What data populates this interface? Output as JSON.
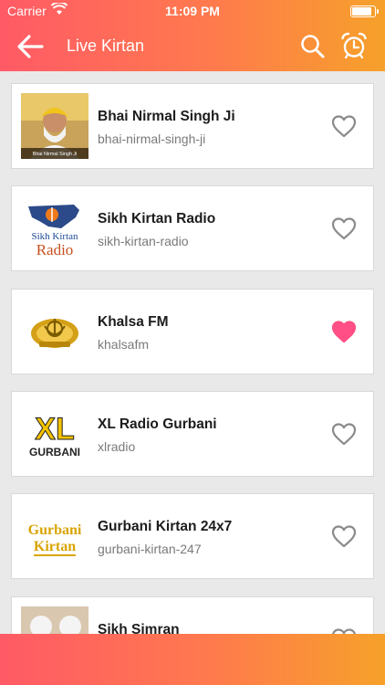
{
  "status_bar": {
    "carrier": "Carrier",
    "time": "11:09 PM"
  },
  "header": {
    "title": "Live Kirtan"
  },
  "stations": [
    {
      "name": "Bhai Nirmal Singh Ji",
      "slug": "bhai-nirmal-singh-ji",
      "favorite": false,
      "thumb_caption": "Bhai Nirmal Singh Ji"
    },
    {
      "name": "Sikh Kirtan Radio",
      "slug": "sikh-kirtan-radio",
      "favorite": false,
      "logo_text": "Sikh Kirtan",
      "logo_text2": "Radio"
    },
    {
      "name": "Khalsa FM",
      "slug": "khalsafm",
      "favorite": true
    },
    {
      "name": "XL Radio Gurbani",
      "slug": "xlradio",
      "favorite": false,
      "logo_text": "XL",
      "logo_text2": "GURBANI"
    },
    {
      "name": "Gurbani Kirtan 24x7",
      "slug": "gurbani-kirtan-247",
      "favorite": false,
      "logo_text": "Gurbani",
      "logo_text2": "Kirtan"
    },
    {
      "name": "Sikh Simran",
      "slug": "",
      "favorite": false
    }
  ],
  "colors": {
    "accent_start": "#ff5a66",
    "accent_end": "#f6a12a",
    "heart_active": "#ff4f86",
    "heart_inactive": "#8a8a8a"
  },
  "icons": {
    "back": "arrow-left-icon",
    "search": "search-icon",
    "alarm": "alarm-clock-icon",
    "favorite": "heart-icon"
  }
}
